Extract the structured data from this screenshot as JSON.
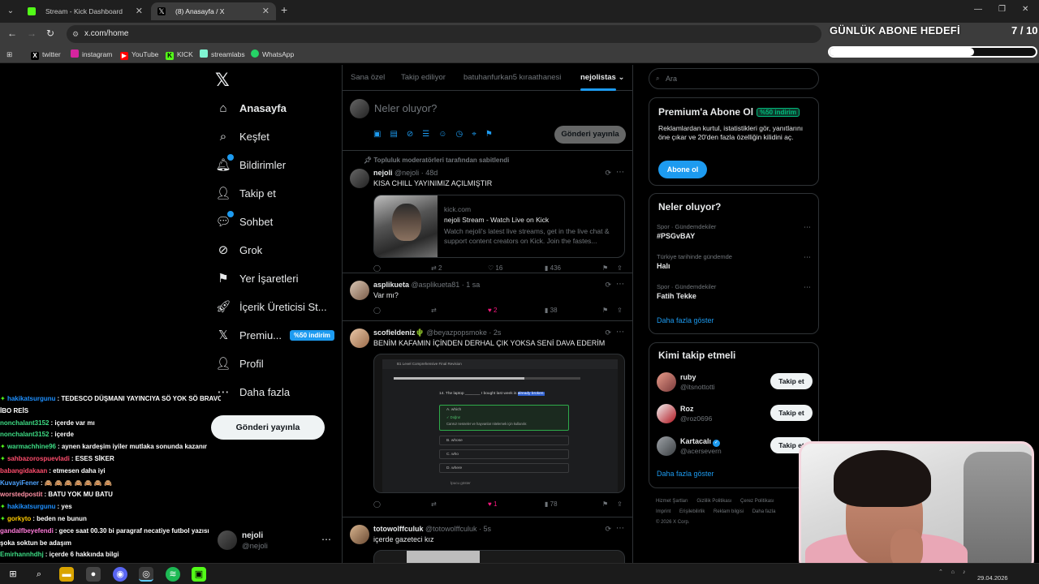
{
  "browser": {
    "tabs": [
      {
        "label": "Stream - Kick Dashboard",
        "active": false
      },
      {
        "label": "(8) Anasayfa / X",
        "active": true
      }
    ],
    "url": "x.com/home",
    "bookmarks": [
      "twitter",
      "instagram",
      "YouTube",
      "KICK",
      "streamlabs",
      "WhatsApp"
    ]
  },
  "overlay": {
    "goal_title": "GÜNLÜK ABONE HEDEFİ",
    "goal_count": "7 / 10",
    "goal_progress": 0.7
  },
  "nav": {
    "items": [
      {
        "label": "Anasayfa",
        "icon": "home-icon"
      },
      {
        "label": "Keşfet",
        "icon": "search-icon"
      },
      {
        "label": "Bildirimler",
        "icon": "bell-icon"
      },
      {
        "label": "Takip et",
        "icon": "person-add-icon"
      },
      {
        "label": "Sohbet",
        "icon": "chat-icon"
      },
      {
        "label": "Grok",
        "icon": "grok-icon"
      },
      {
        "label": "Yer İşaretleri",
        "icon": "bookmark-icon"
      },
      {
        "label": "İçerik Üreticisi St...",
        "icon": "rocket-icon"
      },
      {
        "label": "Premiu...",
        "icon": "x-icon"
      },
      {
        "label": "Profil",
        "icon": "profile-icon"
      },
      {
        "label": "Daha fazla",
        "icon": "more-circle-icon"
      }
    ],
    "premium_badge": "%50 indirim",
    "post_button": "Gönderi yayınla",
    "account": {
      "name": "nejoli",
      "handle": "@nejoli"
    }
  },
  "chat": [
    {
      "user": "hakikatsurgunu",
      "msg": ": TEDESCO DÜŞMANI YAYINCIYA SÖ YOK SÖ BRAVO",
      "color": "#1e90ff",
      "badge": true
    },
    {
      "user": "",
      "msg": "İBO REİS",
      "color": "#fff",
      "badge": false
    },
    {
      "user": "nonchalant3152",
      "msg": ": içerde var mı",
      "color": "#3ddc84",
      "badge": false
    },
    {
      "user": "nonchalant3152",
      "msg": ": içerde",
      "color": "#3ddc84",
      "badge": false
    },
    {
      "user": "warmachhine96",
      "msg": ": aynen kardeşim iyiler mutlaka sonunda kazanır",
      "color": "#3ddc84",
      "badge": true
    },
    {
      "user": "sahbazorospuevladi",
      "msg": ": ESES SİKER",
      "color": "#ff4d6d",
      "badge": true
    },
    {
      "user": "babangidakaan",
      "msg": ": etmesen daha iyi",
      "color": "#ff4d6d",
      "badge": false
    },
    {
      "user": "KuvayiFener",
      "msg": ": 🙈 🙈 🙈 🙈 🙈 🙈 🙈",
      "color": "#4da3ff",
      "badge": false
    },
    {
      "user": "worstedpostit",
      "msg": ": BATU YOK MU BATU",
      "color": "#ff8fa3",
      "badge": false
    },
    {
      "user": "hakikatsurgunu",
      "msg": ": yes",
      "color": "#1e90ff",
      "badge": true
    },
    {
      "user": "gorkyto",
      "msg": ": beden ne bunun",
      "color": "#ffcc00",
      "badge": true
    },
    {
      "user": "gandalfbeyefendi",
      "msg": ": gece saat 00.30 bi paragraf necatiye futbol yazısı",
      "color": "#ff7ad9",
      "badge": false
    },
    {
      "user": "",
      "msg": "şoka soktun be adaşım",
      "color": "#fff",
      "badge": false
    },
    {
      "user": "Emirhannhdhj",
      "msg": ": içerde 6 hakkında bilgi",
      "color": "#3ddc84",
      "badge": false
    }
  ],
  "timeline": {
    "tabs": [
      "Sana özel",
      "Takip ediliyor",
      "batuhanfurkan5 kıraathanesi",
      "nejolistas"
    ],
    "composer_placeholder": "Neler oluyor?",
    "composer_button": "Gönderi yayınla",
    "pinned_label": "Topluluk moderatörleri tarafından sabitlendi",
    "tweets": [
      {
        "name": "nejoli",
        "handle": "@nejoli",
        "time": "48d",
        "text": "KISA CHILL YAYINIMIZ AÇILMIŞTIR",
        "card": {
          "domain": "kick.com",
          "title": "nejoli Stream - Watch Live on Kick",
          "desc": "Watch nejoli's latest live streams, get in the live chat & support content creators on Kick. Join the fastes..."
        },
        "replies": "",
        "retweets": "2",
        "likes": "16",
        "views": "436"
      },
      {
        "name": "asplikueta",
        "handle": "@asplikueta81",
        "time": "1 sa",
        "text": "Var mı?",
        "replies": "",
        "retweets": "",
        "likes": "2",
        "views": "38"
      },
      {
        "name": "scofieldeniz🌵",
        "handle": "@beyazpopsmoke",
        "time": "2s",
        "text": "BENİM KAFAMIN İÇİNDEN DERHAL ÇIK YOKSA SENİ DAVA EDERİM",
        "media": {
          "window_title": "B1 Level Comprehensive Final Revision",
          "question": "14.   The laptop _______ I bought last week is ",
          "highlight": "already broken.",
          "options": [
            {
              "letter": "A.",
              "text": "which",
              "selected": true,
              "feedback": "✓ Doğru!",
              "note": "Cansız nesneler ve hayvanlar nitelemek için kullanılır."
            },
            {
              "letter": "B.",
              "text": "whose"
            },
            {
              "letter": "C.",
              "text": "who"
            },
            {
              "letter": "D.",
              "text": "where"
            }
          ],
          "show_label": "İpucu göster"
        },
        "replies": "",
        "retweets": "",
        "likes": "1",
        "views": "78"
      },
      {
        "name": "totowolffculuk",
        "handle": "@totowolffculuk",
        "time": "5s",
        "text": "içerde gazeteci kız"
      }
    ]
  },
  "sidebar": {
    "search_placeholder": "Ara",
    "premium": {
      "title": "Premium'a Abone Ol",
      "badge": "%50 indirim",
      "text": "Reklamlardan kurtul, istatistikleri gör, yanıtlarını öne çıkar ve 20'den fazla özelliğin kilidini aç.",
      "button": "Abone ol"
    },
    "trends_title": "Neler oluyor?",
    "trends": [
      {
        "category": "Spor · Gündemdekiler",
        "name": "#PSGvBAY"
      },
      {
        "category": "Türkiye tarihinde gündemde",
        "name": "Halı"
      },
      {
        "category": "Spor · Gündemdekiler",
        "name": "Fatih Tekke"
      }
    ],
    "show_more": "Daha fazla göster",
    "who_title": "Kimi takip etmeli",
    "who": [
      {
        "name": "ruby",
        "handle": "@itsnottotti",
        "verified": false
      },
      {
        "name": "Roz",
        "handle": "@roz0696",
        "verified": false
      },
      {
        "name": "Kartacalı",
        "handle": "@acersevern",
        "verified": true
      }
    ],
    "follow_button": "Takip et",
    "footer": [
      "Hizmet Şartları",
      "Gizlilik Politikası",
      "Çerez Politikası",
      "Imprint",
      "Erişilebilirlik",
      "Reklam bilgisi",
      "Daha fazla",
      "© 2026 X Corp."
    ]
  },
  "taskbar": {
    "date": "29.04.2026"
  }
}
